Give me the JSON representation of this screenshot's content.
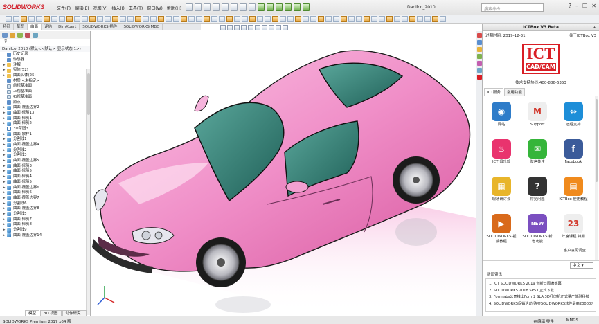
{
  "app": {
    "logo_text": "SOLIDWORKS",
    "document_title": "Danilco_2010",
    "search_placeholder": "搜索命令"
  },
  "menu": [
    "文件(F)",
    "编辑(E)",
    "视图(V)",
    "插入(I)",
    "工具(T)",
    "窗口(W)",
    "帮助(H)"
  ],
  "command_tabs": [
    "特征",
    "草图",
    "曲面",
    "评估",
    "DimXpert",
    "SOLIDWORKS 插件",
    "SOLIDWORKS MBD"
  ],
  "tree": {
    "root": "Danilco_2010 (默认<<默认>_显示状态 1>)",
    "items": [
      {
        "label": "历史记录",
        "icon": "history-icon",
        "exp": ""
      },
      {
        "label": "传感器",
        "icon": "sensor-icon",
        "exp": ""
      },
      {
        "label": "注解",
        "icon": "annotation-icon",
        "exp": "▸"
      },
      {
        "label": "实体(52)",
        "icon": "solid-bodies-icon",
        "exp": "▸"
      },
      {
        "label": "曲面实体(25)",
        "icon": "surface-bodies-icon",
        "exp": "▸"
      },
      {
        "label": "材质 <未指定>",
        "icon": "material-icon",
        "exp": ""
      },
      {
        "label": "前视基准面",
        "icon": "plane-icon",
        "exp": ""
      },
      {
        "label": "上视基准面",
        "icon": "plane-icon",
        "exp": ""
      },
      {
        "label": "右视基准面",
        "icon": "plane-icon",
        "exp": ""
      },
      {
        "label": "原点",
        "icon": "origin-icon",
        "exp": ""
      },
      {
        "label": "曲面-覆盖边界2",
        "icon": "surface-icon",
        "exp": "▸"
      },
      {
        "label": "曲面-修剪13",
        "icon": "surface-icon",
        "exp": "▸"
      },
      {
        "label": "曲面-修剪1",
        "icon": "surface-icon",
        "exp": "▸"
      },
      {
        "label": "曲面-修剪2",
        "icon": "surface-icon",
        "exp": "▸"
      },
      {
        "label": "3D草图3",
        "icon": "sketch-icon",
        "exp": ""
      },
      {
        "label": "曲面-放样1",
        "icon": "surface-icon",
        "exp": "▸"
      },
      {
        "label": "分割线1",
        "icon": "split-line-icon",
        "exp": "▸"
      },
      {
        "label": "曲面-覆盖边界4",
        "icon": "surface-icon",
        "exp": "▸"
      },
      {
        "label": "分割线2",
        "icon": "split-line-icon",
        "exp": "▸"
      },
      {
        "label": "分割线3",
        "icon": "split-line-icon",
        "exp": "▸"
      },
      {
        "label": "曲面-覆盖边界5",
        "icon": "surface-icon",
        "exp": "▸"
      },
      {
        "label": "曲面-修剪3",
        "icon": "surface-icon",
        "exp": "▸"
      },
      {
        "label": "曲面-修剪5",
        "icon": "surface-icon",
        "exp": "▸"
      },
      {
        "label": "曲面-修剪4",
        "icon": "surface-icon",
        "exp": "▸"
      },
      {
        "label": "曲面-修剪5",
        "icon": "surface-icon",
        "exp": "▸"
      },
      {
        "label": "曲面-覆盖边界6",
        "icon": "surface-icon",
        "exp": "▸"
      },
      {
        "label": "曲面-修剪6",
        "icon": "surface-icon",
        "exp": "▸"
      },
      {
        "label": "曲面-覆盖边界7",
        "icon": "surface-icon",
        "exp": "▸"
      },
      {
        "label": "分割线6",
        "icon": "split-line-icon",
        "exp": "▸"
      },
      {
        "label": "曲面-覆盖边界8",
        "icon": "surface-icon",
        "exp": "▸"
      },
      {
        "label": "分割线5",
        "icon": "split-line-icon",
        "exp": "▸"
      },
      {
        "label": "曲面-修剪7",
        "icon": "surface-icon",
        "exp": "▸"
      },
      {
        "label": "曲面-修剪8",
        "icon": "surface-icon",
        "exp": "▸"
      },
      {
        "label": "分割线9",
        "icon": "split-line-icon",
        "exp": "▸"
      },
      {
        "label": "曲面-覆盖边界14",
        "icon": "surface-icon",
        "exp": "▸"
      }
    ]
  },
  "bottom_tabs": [
    "模型",
    "3D 视图",
    "动作研究1"
  ],
  "pane": {
    "title": "ICTBox V3 Beta",
    "expire": "过期时间: 2019-12-31",
    "about": "关于ICTBox V3",
    "logo_top": "ICT",
    "logo_bottom": "CAD/CAM",
    "support_line": "技术支持热线:400-886-6353",
    "tabs": [
      "ICT服务",
      "常用功能"
    ],
    "grid": [
      {
        "label": "网站",
        "icon": "web-globe-icon",
        "bg": "#2e7cc9",
        "glyph": "◉"
      },
      {
        "label": "Support",
        "icon": "gmail-icon",
        "bg": "#eeeeee",
        "glyph": "M"
      },
      {
        "label": "远程支持",
        "icon": "teamviewer-icon",
        "bg": "#1d8ed8",
        "glyph": "⇔"
      },
      {
        "label": "ICT 俱乐部",
        "icon": "club-cup-icon",
        "bg": "#e9336e",
        "glyph": "♨"
      },
      {
        "label": "微信关注",
        "icon": "wechat-icon",
        "bg": "#35b53a",
        "glyph": "✉"
      },
      {
        "label": "Facebook",
        "icon": "facebook-icon",
        "bg": "#3b5b9a",
        "glyph": "f"
      },
      {
        "label": "现场研讨会",
        "icon": "seminar-icon",
        "bg": "#e8b52a",
        "glyph": "▦"
      },
      {
        "label": "常见问题",
        "icon": "faq-question-icon",
        "bg": "#333333",
        "glyph": "?"
      },
      {
        "label": "ICTBox 使用教程",
        "icon": "tutorial-icon",
        "bg": "#f08a1d",
        "glyph": "▤"
      },
      {
        "label": "SOLIDWORKS 视频教程",
        "icon": "video-tutorial-icon",
        "bg": "#d96a1b",
        "glyph": "▶"
      },
      {
        "label": "SOLIDWORKS 新增功能",
        "icon": "new-features-icon",
        "bg": "#7b4fc0",
        "glyph": "NEW"
      },
      {
        "label": "年度课程 排期",
        "icon": "calendar-icon",
        "bg": "#eeeeee",
        "glyph": "23"
      }
    ],
    "last_cell": "客户意见调查",
    "language": "中文",
    "news_title": "新闻资讯",
    "news": [
      "1. ICT SOLIDWORKS 2019 创新日圆满落幕",
      "2. SOLIDWORKS 2018 SP5.0正式下载",
      "3. Formlabs公司推出Form2 SLA 3D打印机正式量产能耐科技",
      "4. SOLIDWORKS促销活动:购买SOLIDWORKS软件最高20000元大礼"
    ]
  },
  "status": {
    "product": "SOLIDWORKS Premium 2017 x64 版",
    "editing": "在编辑 零件",
    "units": "MMGS"
  },
  "colors": {
    "car_body": "#f08fc8",
    "glass": "#2f7d73",
    "accent": "#d21f2a"
  }
}
